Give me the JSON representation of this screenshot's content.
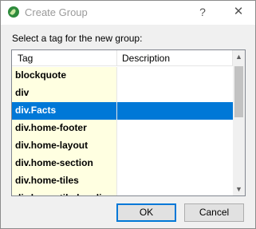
{
  "window": {
    "title": "Create Group",
    "help_label": "?",
    "close_label": "✕"
  },
  "prompt": "Select a tag for the new group:",
  "table": {
    "columns": [
      "Tag",
      "Description"
    ],
    "rows": [
      {
        "tag": "blockquote",
        "description": ""
      },
      {
        "tag": "div",
        "description": ""
      },
      {
        "tag": "div.Facts",
        "description": "",
        "selected": true
      },
      {
        "tag": "div.home-footer",
        "description": ""
      },
      {
        "tag": "div.home-layout",
        "description": ""
      },
      {
        "tag": "div.home-section",
        "description": ""
      },
      {
        "tag": "div.home-tiles",
        "description": ""
      },
      {
        "tag": "div.home-tile-heading",
        "description": ""
      }
    ]
  },
  "scrollbar": {
    "up_icon": "▲",
    "down_icon": "▼"
  },
  "buttons": {
    "ok": "OK",
    "cancel": "Cancel"
  },
  "colors": {
    "selection": "#0078d7",
    "tag_cell_bg": "#ffffe1",
    "app_icon": "#2e8b3c"
  }
}
